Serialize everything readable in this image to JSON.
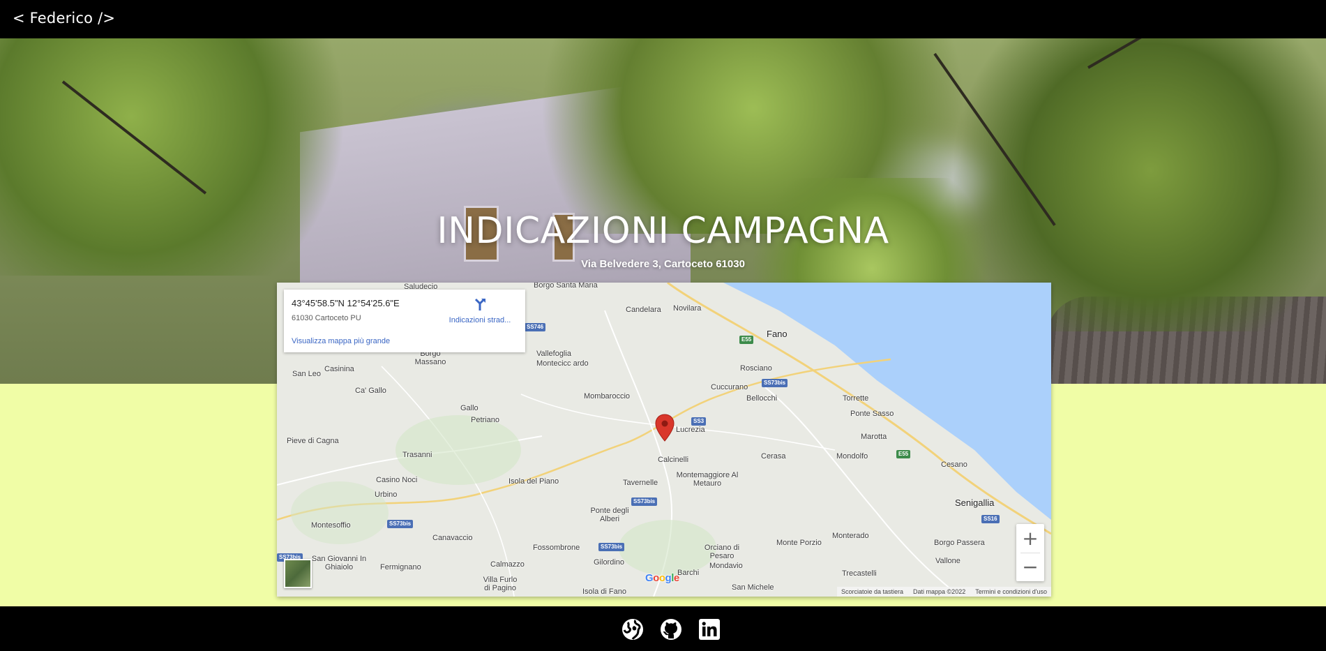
{
  "header": {
    "brand": "< Federico />"
  },
  "hero": {
    "title": "INDICAZIONI CAMPAGNA",
    "subtitle": "Via Belvedere 3, Cartoceto 61030"
  },
  "map": {
    "info_card": {
      "coordinates": "43°45'58.5\"N 12°54'25.6\"E",
      "address": "61030 Cartoceto PU",
      "directions_label": "Indicazioni strad...",
      "larger_map_link": "Visualizza mappa più grande"
    },
    "places": [
      "Saludecio",
      "Borgo Santa Maria",
      "Candelara",
      "Novilara",
      "Fano",
      "Rosciano",
      "San Leo",
      "Casinina",
      "Borgo Massano",
      "Vallefoglia",
      "Montecicc ardo",
      "Ca' Gallo",
      "Cuccurano",
      "Bellocchi",
      "Torrette",
      "Ponte Sasso",
      "Mombaroccio",
      "Gallo",
      "Petriano",
      "Lucrezia",
      "Pieve di Cagna",
      "Trasanni",
      "Calcinelli",
      "Cerasa",
      "Mondolfo",
      "Marotta",
      "Cesano",
      "Casino Noci",
      "Isola del Piano",
      "Tavernelle",
      "Montemaggiore Al Metauro",
      "Urbino",
      "Senigallia",
      "Ponte degli Alberi",
      "Montesoffio",
      "Canavaccio",
      "Fossombrone",
      "Orciano di Pesaro",
      "Monte Porzio",
      "Monterado",
      "Borgo Passera",
      "San Giovanni In Ghiaiolo",
      "Fermignano",
      "Calmazzo",
      "Gilordino",
      "Mondavio",
      "Vallone",
      "Villa Furlo di Pagino",
      "Barchi",
      "Trecastelli",
      "Isola di Fano",
      "San Michele"
    ],
    "shields": [
      "SS746",
      "E55",
      "SS73bis",
      "SS3",
      "E55",
      "SS16",
      "SS73bis",
      "SS73bis",
      "SS73bis",
      "SS73bis"
    ],
    "zoom_in": "+",
    "zoom_out": "−",
    "google": [
      "G",
      "o",
      "o",
      "g",
      "l",
      "e"
    ],
    "attribution": {
      "shortcuts": "Scorciatoie da tastiera",
      "data": "Dati mappa ©2022",
      "terms": "Termini e condizioni d'uso"
    },
    "colors": {
      "sea": "#abd0fb",
      "land": "#e9eae4",
      "pin": "#d9372b",
      "highway": "#f2d27a"
    }
  },
  "footer": {
    "icons": [
      "globe-icon",
      "github-icon",
      "linkedin-icon"
    ]
  }
}
